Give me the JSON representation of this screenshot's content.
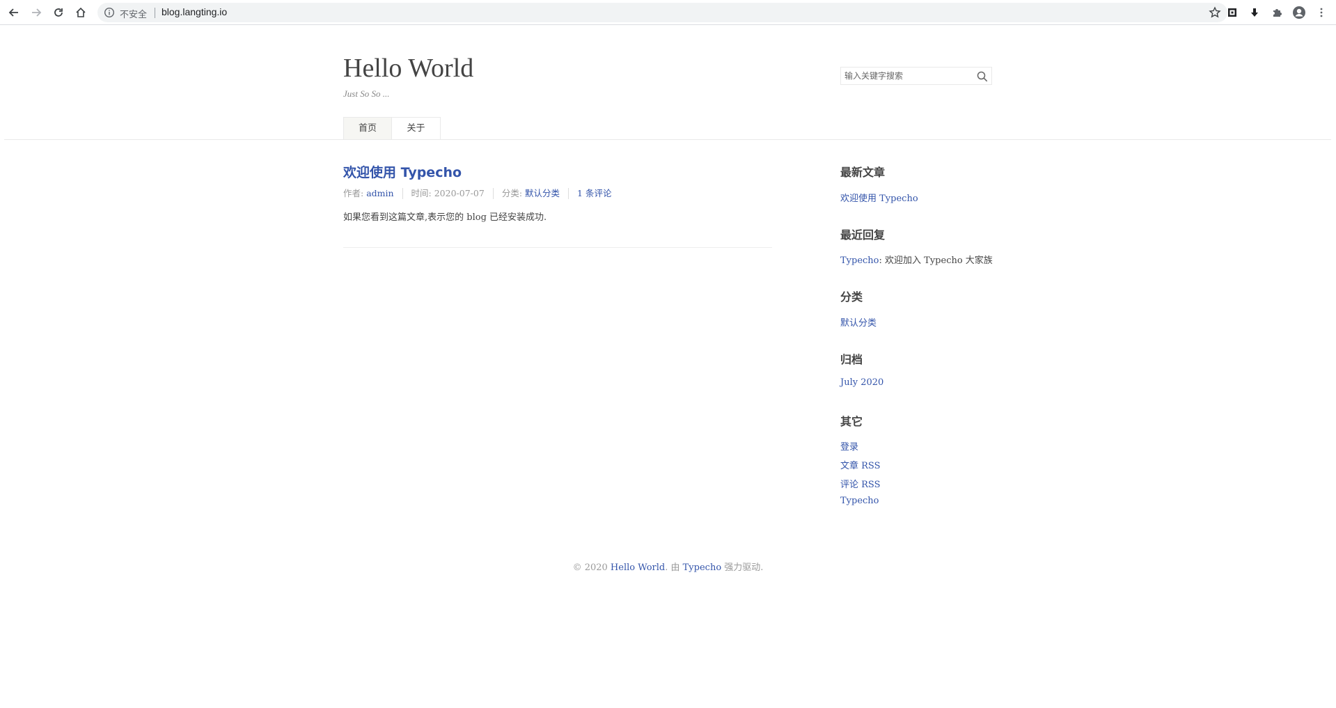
{
  "browser": {
    "security_label": "不安全",
    "url": "blog.langting.io"
  },
  "site": {
    "title": "Hello World",
    "description": "Just So So ...",
    "search_placeholder": "输入关键字搜索"
  },
  "nav": {
    "items": [
      {
        "label": "首页",
        "current": true
      },
      {
        "label": "关于",
        "current": false
      }
    ]
  },
  "post": {
    "title": "欢迎使用 Typecho",
    "author_prefix": "作者: ",
    "author": "admin",
    "time": "时间: 2020-07-07",
    "category_prefix": "分类: ",
    "category": "默认分类",
    "comments": "1 条评论",
    "content": "如果您看到这篇文章,表示您的 blog 已经安装成功."
  },
  "sidebar": {
    "recent_posts_title": "最新文章",
    "recent_posts": [
      "欢迎使用 Typecho"
    ],
    "recent_comments_title": "最近回复",
    "recent_comment_author": "Typecho",
    "recent_comment_text": ": 欢迎加入 Typecho 大家族",
    "categories_title": "分类",
    "categories": [
      "默认分类"
    ],
    "archives_title": "归档",
    "archives": [
      "July 2020"
    ],
    "other_title": "其它",
    "other_links": [
      "登录",
      "文章 RSS",
      "评论 RSS",
      "Typecho"
    ]
  },
  "footer": {
    "copyright": "© 2020 ",
    "site_link": "Hello World",
    "by": ". 由 ",
    "powered_link": "Typecho",
    "suffix": " 强力驱动."
  }
}
